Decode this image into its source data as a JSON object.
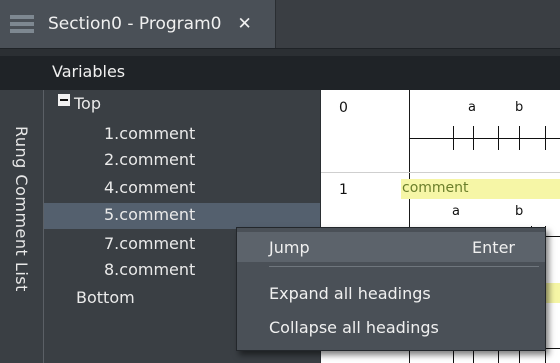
{
  "tab": {
    "title": "Section0 - Program0",
    "close": "✕"
  },
  "variables_bar": {
    "label": "Variables"
  },
  "side_panel": {
    "label": "Rung Comment List"
  },
  "tree": {
    "items": [
      {
        "label": "Top",
        "expanded": true
      },
      {
        "label": "1.comment"
      },
      {
        "label": "2.comment"
      },
      {
        "label": "4.comment"
      },
      {
        "label": "5.comment",
        "selected": true
      },
      {
        "label": "7.comment"
      },
      {
        "label": "8.comment"
      },
      {
        "label": "Bottom"
      }
    ]
  },
  "ladder": {
    "rungs": [
      {
        "number": "0",
        "contacts": [
          "a",
          "b"
        ]
      },
      {
        "number": "1",
        "comment": "comment",
        "contacts": [
          "a",
          "b"
        ]
      }
    ]
  },
  "context_menu": {
    "items": [
      {
        "label": "Jump",
        "shortcut": "Enter"
      },
      {
        "label": "Expand all headings"
      },
      {
        "label": "Collapse all headings"
      }
    ]
  },
  "colors": {
    "tab_active": "#4a5057",
    "panel_bg": "#3a3f44",
    "selected_row": "#54606e",
    "comment_highlight": "#f6f6a6",
    "menu_bg": "#4a5057"
  }
}
